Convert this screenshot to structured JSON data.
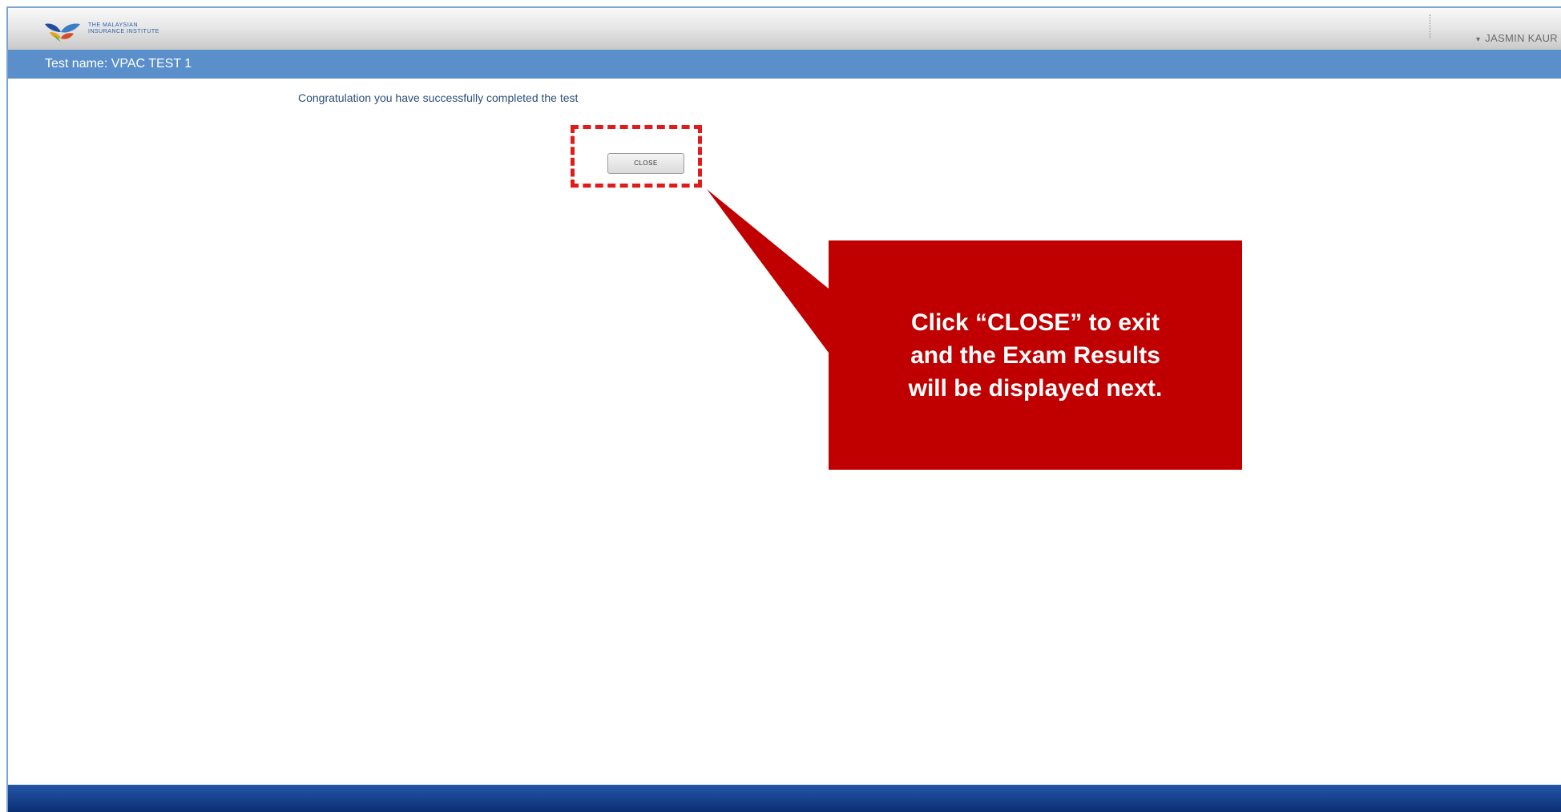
{
  "header": {
    "logo_lines": [
      "THE MALAYSIAN",
      "INSURANCE INSTITUTE"
    ],
    "user_name": "JASMIN KAUR",
    "user_icon": "person-icon"
  },
  "test_bar": {
    "title": "Test name: VPAC TEST 1"
  },
  "main": {
    "message": "Congratulation you have successfully completed the test",
    "close_label": "CLOSE"
  },
  "callout": {
    "lines": [
      "Click “CLOSE” to exit",
      "and the Exam Results",
      "will be displayed next."
    ],
    "color": "#c00000",
    "highlight_color": "#e01b1b"
  },
  "colors": {
    "test_bar": "#5b8fcb",
    "footer": "#0c2e73",
    "message_text": "#2b4f7a"
  }
}
